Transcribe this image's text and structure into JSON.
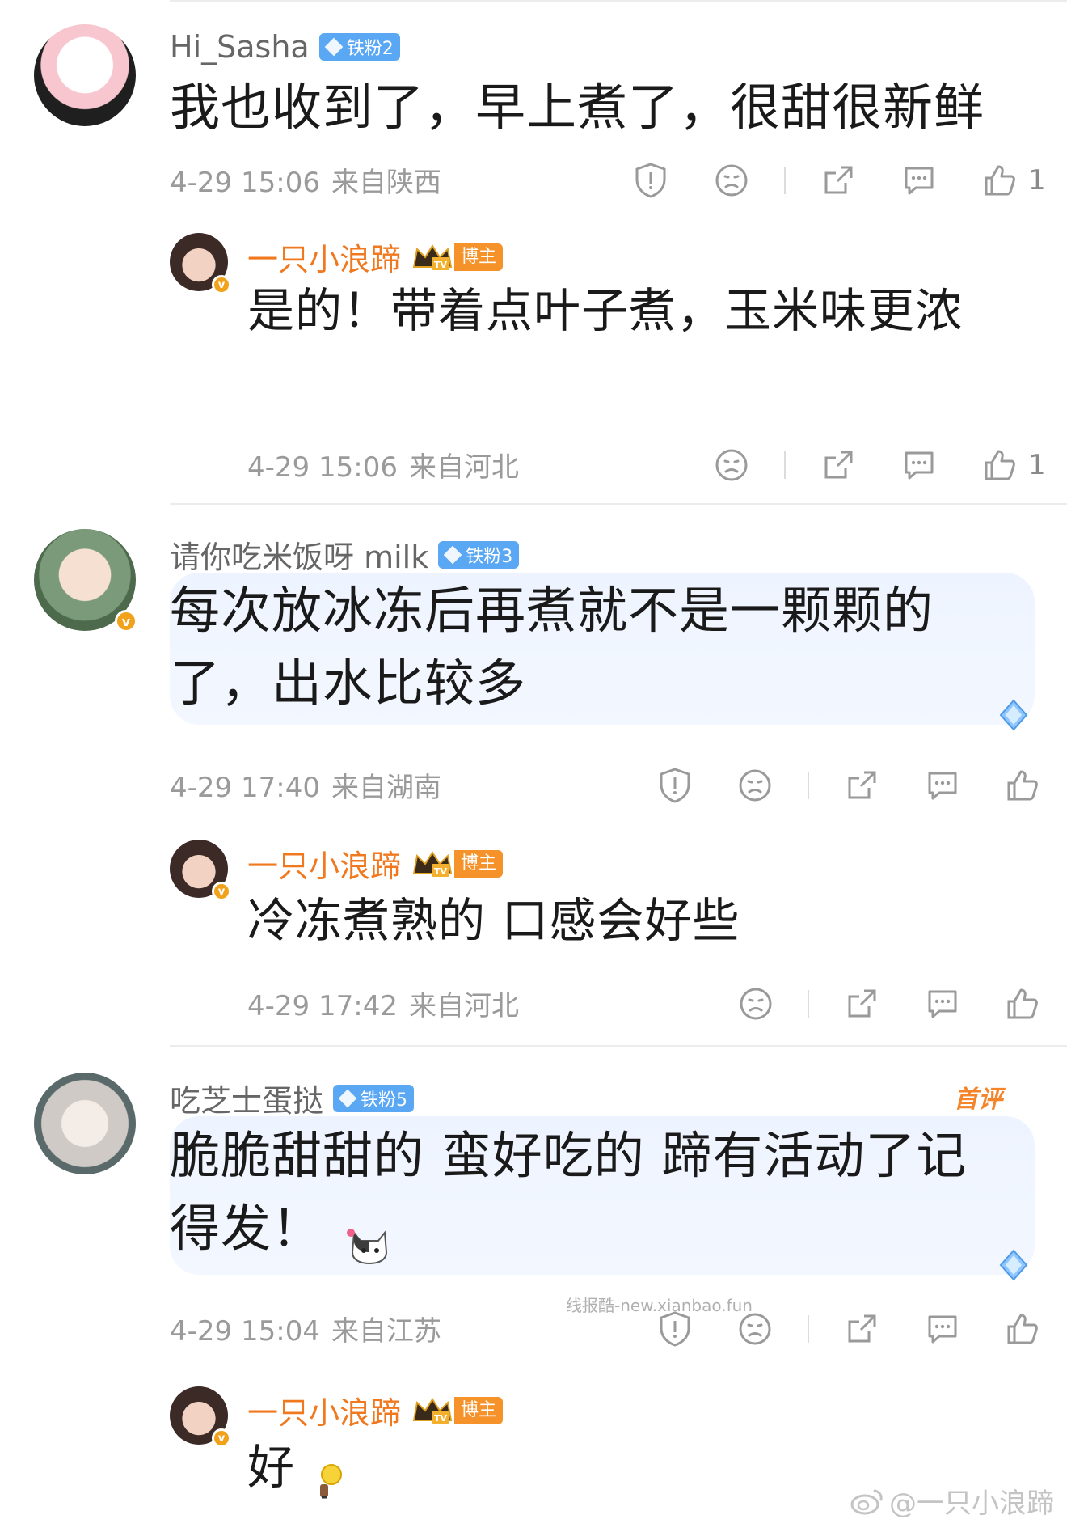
{
  "comments": [
    {
      "user": "Hi_Sasha",
      "fan_badge": "铁粉2",
      "text": "我也收到了，早上煮了，很甜很新鲜",
      "time": "4-29 15:06",
      "location": "来自陕西",
      "likes": "1",
      "reply": {
        "user": "一只小浪蹄",
        "badge": "博主",
        "text": "是的！带着点叶子煮，玉米味更浓",
        "time": "4-29 15:06",
        "location": "来自河北",
        "likes": "1"
      }
    },
    {
      "user": "请你吃米饭呀 milk",
      "fan_badge": "铁粉3",
      "text": "每次放冰冻后再煮就不是一颗颗的了，出水比较多",
      "time": "4-29 17:40",
      "location": "来自湖南",
      "likes": "",
      "reply": {
        "user": "一只小浪蹄",
        "badge": "博主",
        "text": "冷冻煮熟的 口感会好些",
        "time": "4-29 17:42",
        "location": "来自河北",
        "likes": ""
      }
    },
    {
      "user": "吃芝士蛋挞",
      "fan_badge": "铁粉5",
      "first_flag": "首评",
      "text": "脆脆甜甜的 蛮好吃的 蹄有活动了记得发！",
      "time": "4-29 15:04",
      "location": "来自江苏",
      "likes": "",
      "reply": {
        "user": "一只小浪蹄",
        "badge": "博主",
        "text": "好",
        "time": "",
        "location": "",
        "likes": ""
      }
    }
  ],
  "watermarks": {
    "middle": "线报酷-new.xianbao.fun",
    "corner": "@一只小浪蹄"
  },
  "colors": {
    "author": "#f0781e",
    "fan_badge": "#5aa7f4",
    "bubble": "#eef4ff"
  },
  "icons": [
    "report-icon",
    "dislike-face-icon",
    "share-icon",
    "comment-icon",
    "like-thumb-icon"
  ]
}
